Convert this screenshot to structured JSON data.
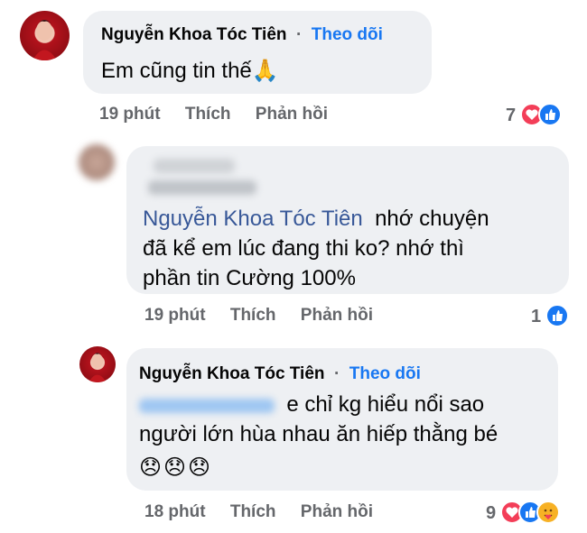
{
  "comments": [
    {
      "author": "Nguyễn Khoa Tóc Tiên",
      "separator": "·",
      "follow_label": "Theo dõi",
      "text": "Em cũng tin thế",
      "emoji": "🙏",
      "time": "19 phút",
      "like_label": "Thích",
      "reply_label": "Phản hồi",
      "reaction_count": "7",
      "reactions": [
        "love-reaction",
        "like-reaction"
      ]
    },
    {
      "mention": "Nguyễn Khoa Tóc Tiên",
      "text_line1": "nhớ chuyện",
      "text_line2": "đã kể em lúc đang thi ko? nhớ thì",
      "text_line3": "phần tin Cường 100%",
      "time": "19 phút",
      "like_label": "Thích",
      "reply_label": "Phản hồi",
      "reaction_count": "1",
      "reactions": [
        "like-reaction"
      ]
    },
    {
      "author": "Nguyễn Khoa Tóc Tiên",
      "separator": "·",
      "follow_label": "Theo dõi",
      "text_line1": "e chỉ kg hiểu nổi sao",
      "text_line2": "người lớn hùa nhau ăn hiếp thằng bé",
      "emojis": "😞😞😞",
      "time": "18 phút",
      "like_label": "Thích",
      "reply_label": "Phản hồi",
      "reaction_count": "9",
      "reactions": [
        "love-reaction",
        "like-reaction",
        "care-reaction"
      ]
    }
  ],
  "colors": {
    "bubble": "#eef0f3",
    "link": "#1877f2",
    "mention": "#385898",
    "meta": "#65676b",
    "like": "#1877f2",
    "love": "#f33e58",
    "care": "#f7b125"
  }
}
